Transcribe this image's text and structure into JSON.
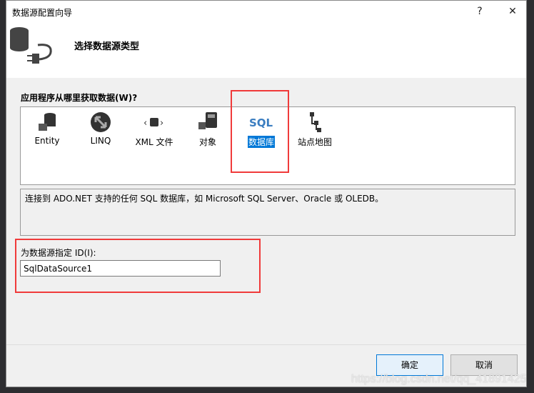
{
  "window": {
    "title": "数据源配置向导",
    "help": "?",
    "close": "✕"
  },
  "header": {
    "step_title": "选择数据源类型"
  },
  "source_prompt": "应用程序从哪里获取数据(W)?",
  "source_items": [
    {
      "label": "Entity",
      "icon": "entity-icon"
    },
    {
      "label": "LINQ",
      "icon": "linq-icon"
    },
    {
      "label": "XML 文件",
      "icon": "xml-file-icon"
    },
    {
      "label": "对象",
      "icon": "object-icon"
    },
    {
      "label": "数据库",
      "icon": "sql-database-icon",
      "selected": true
    },
    {
      "label": "站点地图",
      "icon": "site-map-icon"
    }
  ],
  "description": "连接到 ADO.NET 支持的任何 SQL 数据库，如 Microsoft SQL Server、Oracle 或 OLEDB。",
  "id_label": "为数据源指定 ID(I):",
  "id_value": "SqlDataSource1",
  "buttons": {
    "ok": "确定",
    "cancel": "取消"
  },
  "watermark": "https://blog.csdn.net/qq_41891425",
  "colors": {
    "accent": "#0078d7",
    "highlight_box": "#f03a3a"
  }
}
